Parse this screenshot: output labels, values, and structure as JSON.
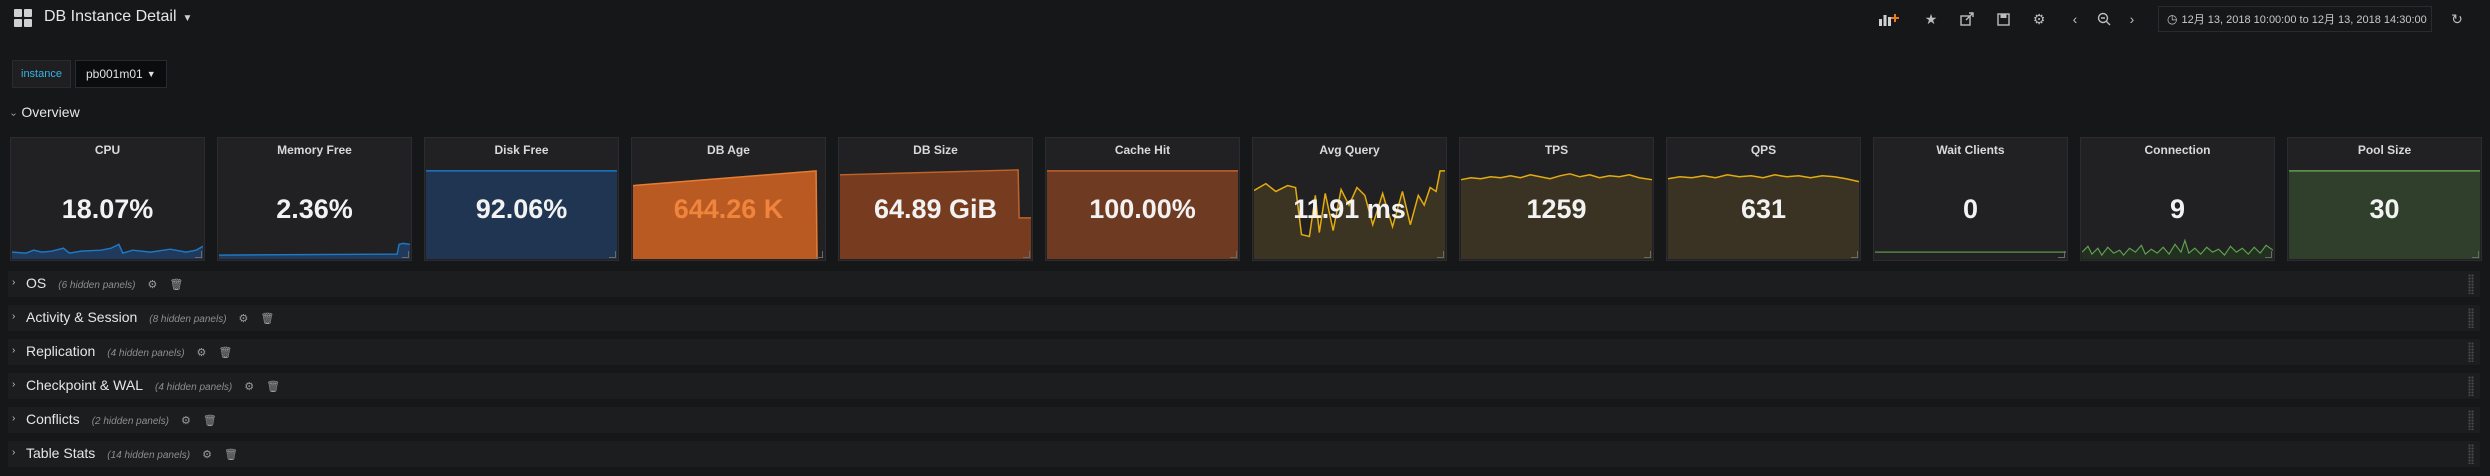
{
  "header": {
    "title": "DB Instance Detail",
    "time_range": "12月 13, 2018 10:00:00 to 12月 13, 2018 14:30:00",
    "icons": [
      "add-panel-icon",
      "star-icon",
      "share-icon",
      "save-icon",
      "settings-icon",
      "back-icon",
      "zoom-out-icon",
      "forward-icon",
      "clock-icon",
      "refresh-icon"
    ]
  },
  "variables": {
    "label": "instance",
    "value": "pb001m01"
  },
  "overview_title": "Overview",
  "panels": [
    {
      "title": "CPU",
      "value": "18.07%",
      "spark": "bottom",
      "color": "#1f78c1"
    },
    {
      "title": "Memory Free",
      "value": "2.36%",
      "spark": "bottom",
      "color": "#1f78c1"
    },
    {
      "title": "Disk Free",
      "value": "92.06%",
      "bg": "#1f3551",
      "line": "#1f78c1"
    },
    {
      "title": "DB Age",
      "value": "644.26 K",
      "bg": "#b95a22",
      "value_color": "#ef843c"
    },
    {
      "title": "DB Size",
      "value": "64.89 GiB",
      "bg": "#773c20"
    },
    {
      "title": "Cache Hit",
      "value": "100.00%",
      "bg": "#6e3a22"
    },
    {
      "title": "Avg Query",
      "value": "11.91 ms",
      "bg": "#3c3422",
      "line": "#e5ac0e"
    },
    {
      "title": "TPS",
      "value": "1259",
      "bg": "#3a3323",
      "line": "#e5ac0e"
    },
    {
      "title": "QPS",
      "value": "631",
      "bg": "#3a3323",
      "line": "#e5ac0e"
    },
    {
      "title": "Wait Clients",
      "value": "0",
      "line": "#508642"
    },
    {
      "title": "Connection",
      "value": "9",
      "line": "#629e51"
    },
    {
      "title": "Pool Size",
      "value": "30",
      "bg": "#2f3f2c",
      "line": "#629e51"
    }
  ],
  "rows": [
    {
      "title": "OS",
      "hidden": "(6 hidden panels)"
    },
    {
      "title": "Activity & Session",
      "hidden": "(8 hidden panels)"
    },
    {
      "title": "Replication",
      "hidden": "(4 hidden panels)"
    },
    {
      "title": "Checkpoint & WAL",
      "hidden": "(4 hidden panels)"
    },
    {
      "title": "Conflicts",
      "hidden": "(2 hidden panels)"
    },
    {
      "title": "Table Stats",
      "hidden": "(14 hidden panels)"
    }
  ]
}
